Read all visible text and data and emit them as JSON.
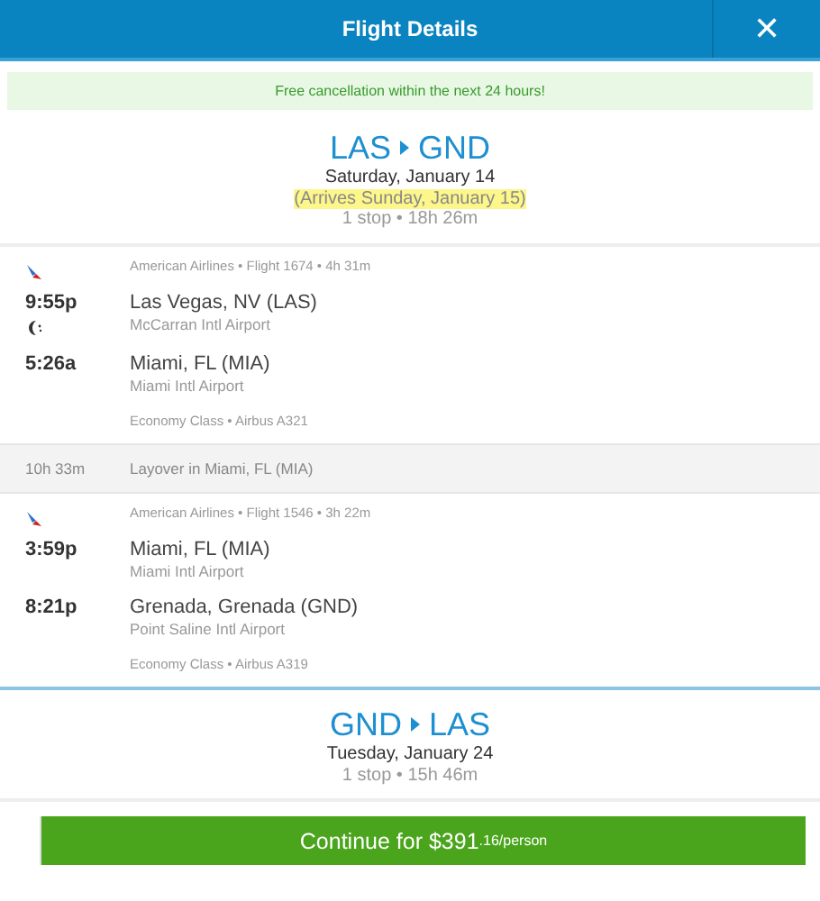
{
  "header": {
    "title": "Flight Details",
    "close": "✕"
  },
  "banner": "Free cancellation within the next 24 hours!",
  "trips": [
    {
      "origin": "LAS",
      "destination": "GND",
      "date": "Saturday, January 14",
      "arrives": "(Arrives Sunday, January 15)",
      "summary": "1 stop • 18h 26m",
      "items": [
        {
          "kind": "segment",
          "info": "American Airlines • Flight 1674 • 4h 31m",
          "stops": [
            {
              "time": "9:55p",
              "city": "Las Vegas, NV (LAS)",
              "airport": "McCarran Intl Airport",
              "overnight": true
            },
            {
              "time": "5:26a",
              "city": "Miami, FL (MIA)",
              "airport": "Miami Intl Airport",
              "overnight": false
            }
          ],
          "cabin": "Economy Class • Airbus A321"
        },
        {
          "kind": "layover",
          "duration": "10h 33m",
          "text": "Layover in Miami, FL (MIA)"
        },
        {
          "kind": "segment",
          "info": "American Airlines • Flight 1546 • 3h 22m",
          "stops": [
            {
              "time": "3:59p",
              "city": "Miami, FL (MIA)",
              "airport": "Miami Intl Airport",
              "overnight": false
            },
            {
              "time": "8:21p",
              "city": "Grenada, Grenada (GND)",
              "airport": "Point Saline Intl Airport",
              "overnight": false
            }
          ],
          "cabin": "Economy Class • Airbus A319"
        }
      ]
    },
    {
      "origin": "GND",
      "destination": "LAS",
      "date": "Tuesday, January 24",
      "summary": "1 stop • 15h 46m"
    }
  ],
  "button": {
    "label": "Continue for $391",
    "suffix": ".16/person"
  }
}
